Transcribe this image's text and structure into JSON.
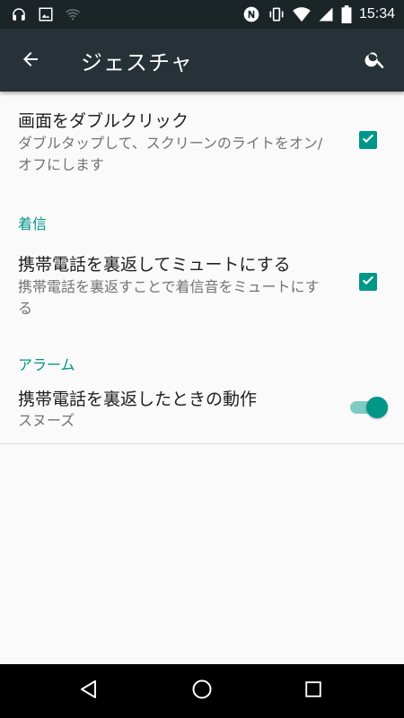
{
  "status_bar": {
    "time": "15:34",
    "left_icons": [
      "headphones-icon",
      "image-icon",
      "wifi-off-icon"
    ],
    "right_icons": [
      "nfc-icon",
      "vibrate-icon",
      "wifi-icon",
      "signal-icon",
      "battery-icon"
    ]
  },
  "app_bar": {
    "title": "ジェスチャ",
    "back_icon": "arrow-back-icon",
    "search_icon": "search-icon"
  },
  "preferences": [
    {
      "title": "画面をダブルクリック",
      "summary": "ダブルタップして、スクリーンのライトをオン/オフにします",
      "control": "checkbox",
      "checked": true
    },
    {
      "section": "着信"
    },
    {
      "title": "携帯電話を裏返してミュートにする",
      "summary": "携帯電話を裏返すことで着信音をミュートにする",
      "control": "checkbox",
      "checked": true
    },
    {
      "section": "アラーム"
    },
    {
      "title": "携帯電話を裏返したときの動作",
      "summary": "スヌーズ",
      "control": "switch",
      "on": true
    }
  ],
  "nav_bar": {
    "buttons": [
      "back-triangle-icon",
      "home-circle-icon",
      "recents-square-icon"
    ]
  },
  "colors": {
    "status_bar": "#1b2528",
    "app_bar": "#263238",
    "accent": "#009688",
    "accent_light": "#80cbc4",
    "background": "#fafafa",
    "nav_bar": "#000000"
  }
}
